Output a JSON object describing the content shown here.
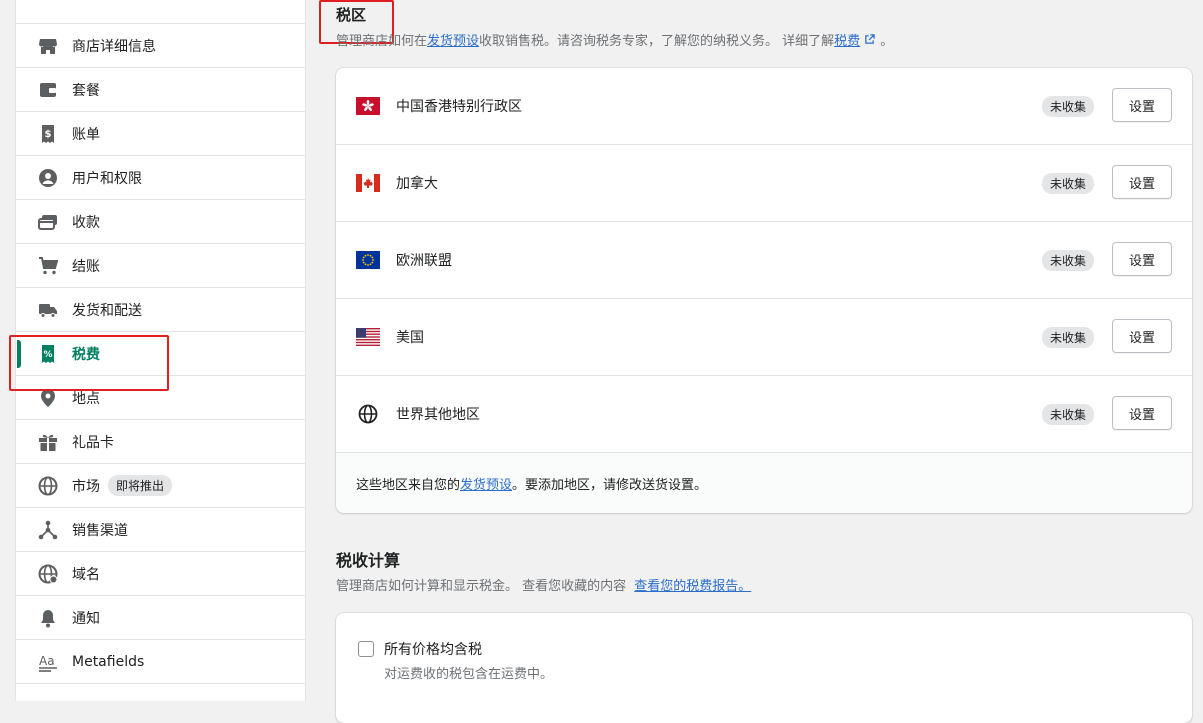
{
  "sidebar": {
    "items": [
      {
        "label": "商店详细信息",
        "icon": "store-icon"
      },
      {
        "label": "套餐",
        "icon": "wallet-icon"
      },
      {
        "label": "账单",
        "icon": "bill-icon"
      },
      {
        "label": "用户和权限",
        "icon": "user-icon"
      },
      {
        "label": "收款",
        "icon": "payments-icon"
      },
      {
        "label": "结账",
        "icon": "cart-icon"
      },
      {
        "label": "发货和配送",
        "icon": "truck-icon"
      },
      {
        "label": "税费",
        "icon": "tax-icon",
        "active": true
      },
      {
        "label": "地点",
        "icon": "location-icon"
      },
      {
        "label": "礼品卡",
        "icon": "gift-icon"
      },
      {
        "label": "市场",
        "icon": "globe-icon",
        "badge": "即将推出"
      },
      {
        "label": "销售渠道",
        "icon": "channels-icon"
      },
      {
        "label": "域名",
        "icon": "domain-icon"
      },
      {
        "label": "通知",
        "icon": "bell-icon"
      },
      {
        "label": "Metafields",
        "icon": "metafields-icon"
      }
    ]
  },
  "regions": {
    "title": "税区",
    "desc_prefix": "管理商店如何在",
    "desc_link1": "发货预设",
    "desc_middle": "收取销售税。请咨询税务专家，了解您的纳税义务。 详细了解",
    "desc_link2": "税费",
    "desc_suffix": "。",
    "zones": [
      {
        "name": "中国香港特别行政区",
        "flag": "hk-flag-icon",
        "status": "未收集",
        "button": "设置"
      },
      {
        "name": "加拿大",
        "flag": "ca-flag-icon",
        "status": "未收集",
        "button": "设置"
      },
      {
        "name": "欧洲联盟",
        "flag": "eu-flag-icon",
        "status": "未收集",
        "button": "设置"
      },
      {
        "name": "美国",
        "flag": "us-flag-icon",
        "status": "未收集",
        "button": "设置"
      },
      {
        "name": "世界其他地区",
        "flag": "world-globe-icon",
        "status": "未收集",
        "button": "设置"
      }
    ],
    "footer_prefix": "这些地区来自您的",
    "footer_link": "发货预设",
    "footer_suffix": "。要添加地区，请修改送货设置。"
  },
  "calc": {
    "title": "税收计算",
    "desc": "管理商店如何计算和显示税金。 查看您收藏的内容",
    "desc_link": "查看您的税费报告。",
    "option_label": "所有价格均含税",
    "option_help": "对运费收的税包含在运费中。",
    "option_checked": false
  },
  "colors": {
    "accent": "#008060",
    "link": "#2c6ecb",
    "highlight": "#e02020"
  }
}
